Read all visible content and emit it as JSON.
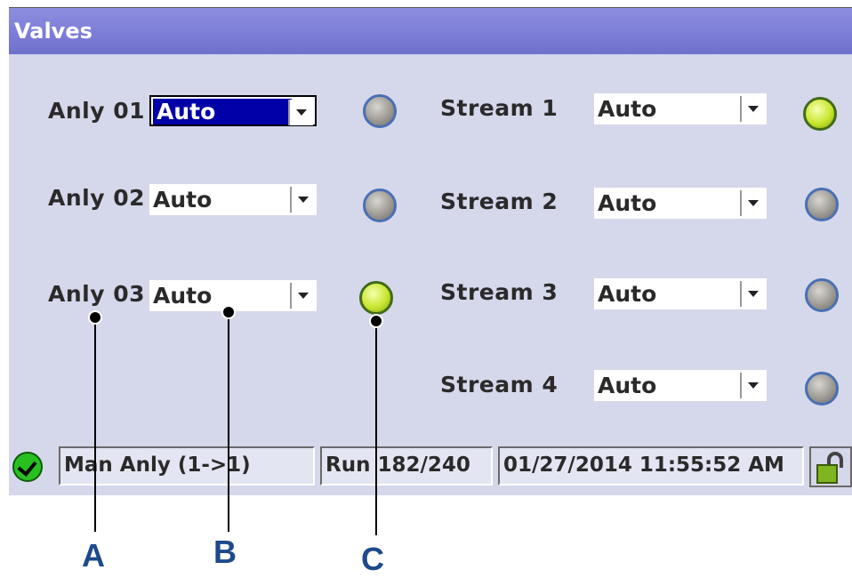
{
  "window": {
    "title": "Valves"
  },
  "analyzers": [
    {
      "label": "Anly 01",
      "mode": "Auto",
      "led": "off",
      "focused": true
    },
    {
      "label": "Anly 02",
      "mode": "Auto",
      "led": "off",
      "focused": false
    },
    {
      "label": "Anly 03",
      "mode": "Auto",
      "led": "on",
      "focused": false
    }
  ],
  "streams": [
    {
      "label": "Stream 1",
      "mode": "Auto",
      "led": "on"
    },
    {
      "label": "Stream 2",
      "mode": "Auto",
      "led": "off"
    },
    {
      "label": "Stream 3",
      "mode": "Auto",
      "led": "off"
    },
    {
      "label": "Stream 4",
      "mode": "Auto",
      "led": "off"
    }
  ],
  "statusbar": {
    "mode": "Man Anly (1->1)",
    "run": "Run 182/240",
    "datetime": "01/27/2014 11:55:52 AM"
  },
  "callouts": {
    "a": "A",
    "b": "B",
    "c": "C"
  },
  "colors": {
    "title_bar": "#7677d4",
    "panel": "#d5d7ea",
    "led_on": "#c8e62e",
    "led_off": "#9e9b94",
    "callout_letter": "#1e4a8a"
  }
}
